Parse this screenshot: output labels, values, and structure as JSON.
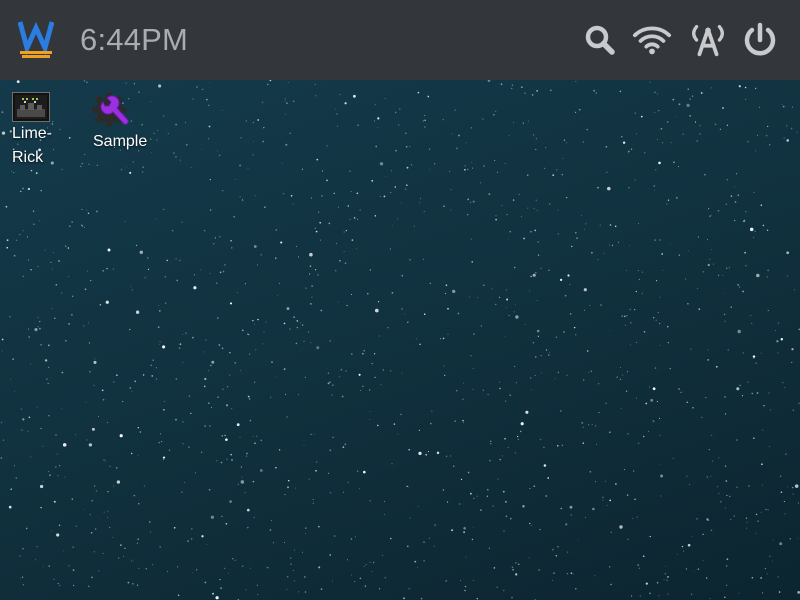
{
  "panel": {
    "clock": "6:44PM",
    "logo_letter": "W",
    "logo_color": "#2b7de0",
    "logo_underline_color": "#f0a020",
    "tray": [
      {
        "name": "search-icon"
      },
      {
        "name": "wifi-icon"
      },
      {
        "name": "antenna-icon"
      },
      {
        "name": "power-icon"
      }
    ]
  },
  "desktop": {
    "icons": [
      {
        "label_line1": "Lime-",
        "label_line2": "Rick",
        "icon": "terminal-app-icon"
      },
      {
        "label": "Sample",
        "icon": "wrench-gear-icon",
        "accent": "#9b30e0"
      }
    ]
  }
}
